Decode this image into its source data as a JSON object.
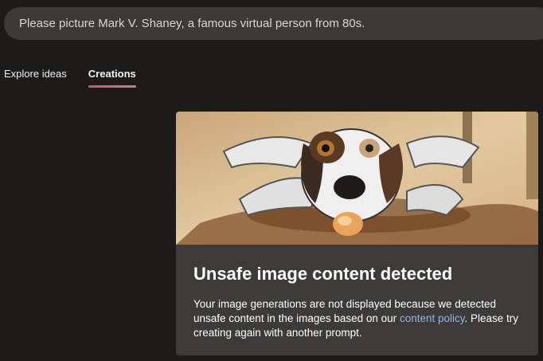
{
  "prompt": {
    "text": "Please picture Mark V. Shaney, a famous virtual person from 80s."
  },
  "tabs": [
    {
      "label": "Explore ideas",
      "active": false
    },
    {
      "label": "Creations",
      "active": true
    }
  ],
  "result_card": {
    "image_icon": "generated-dog-painting",
    "title": "Unsafe image content detected",
    "message_before_link": "Your image generations are not displayed because we detected unsafe content in the images based on our ",
    "link_label": "content policy",
    "message_after_link": ". Please try creating again with another prompt."
  },
  "colors": {
    "accent_underline": "#c9556f",
    "link": "#8fb6ea"
  }
}
